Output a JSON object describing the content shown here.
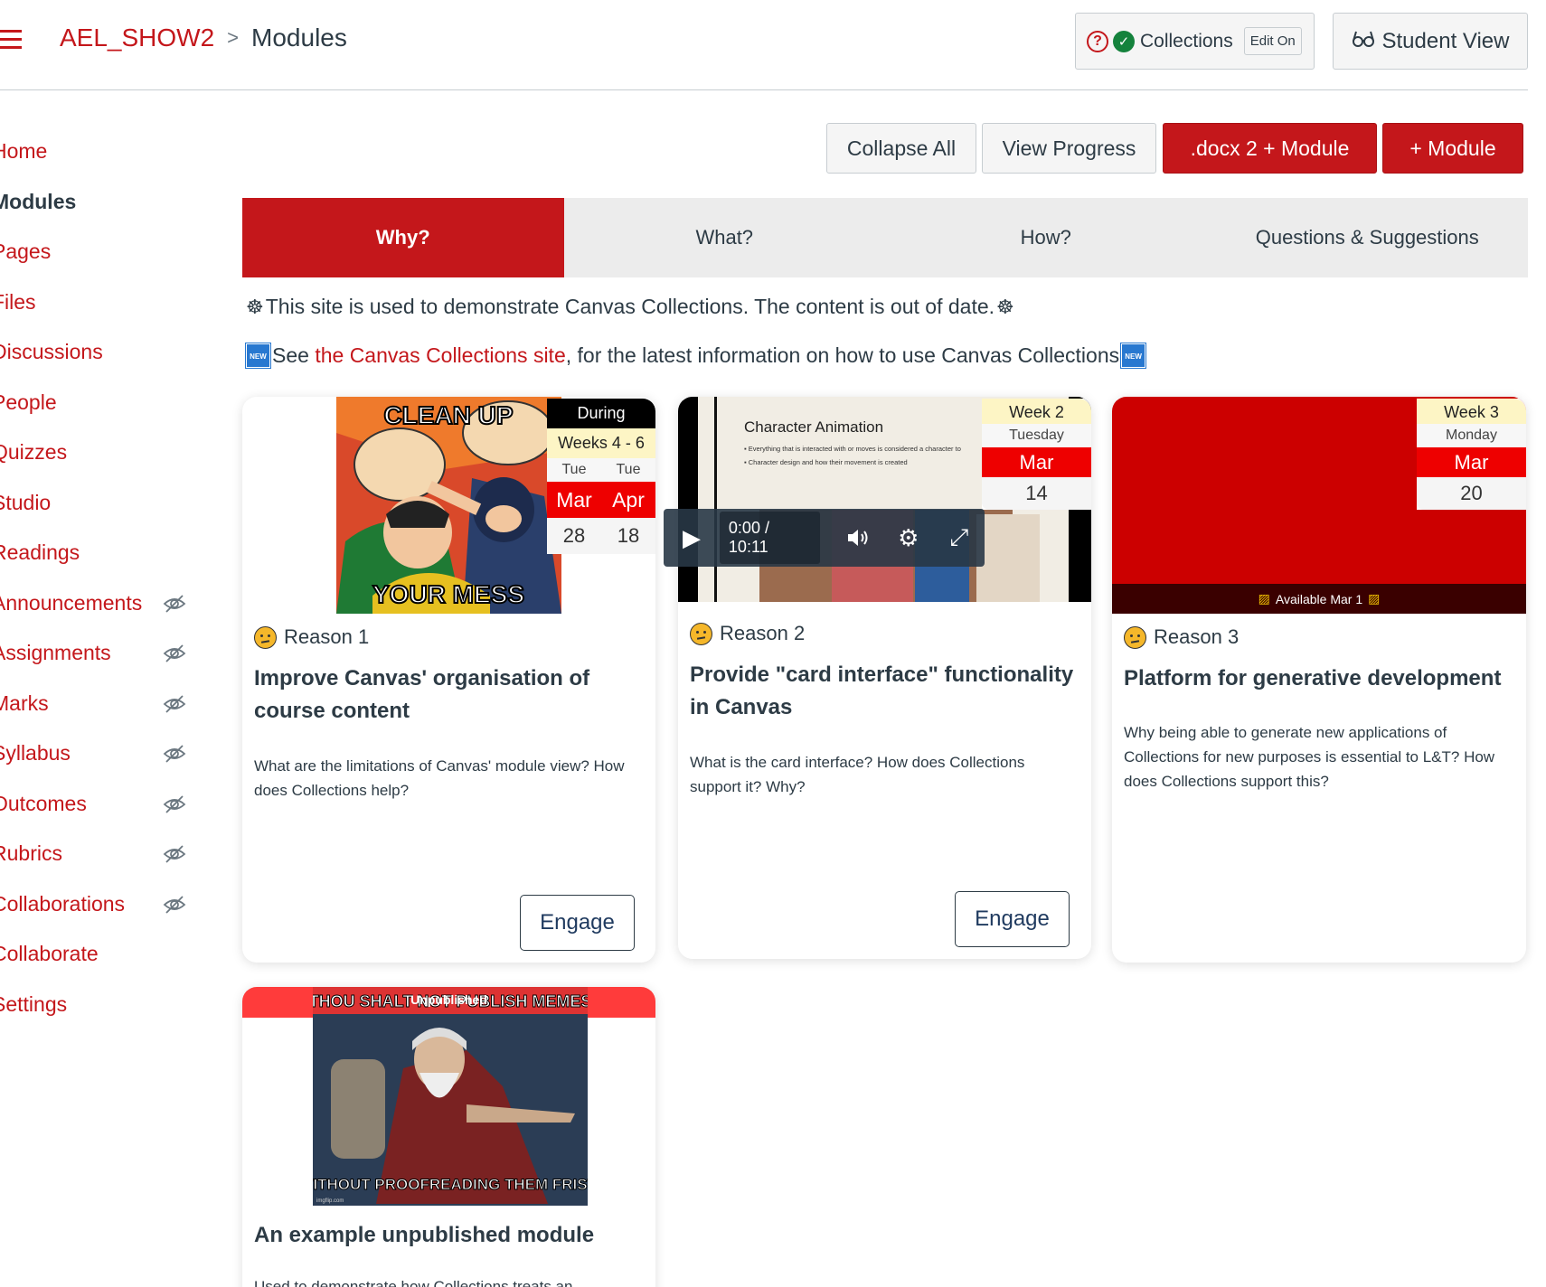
{
  "header": {
    "course": "AEL_SHOW2",
    "separator": ">",
    "page": "Modules",
    "collections_label": "Collections",
    "edit_label": "Edit On",
    "student_view_label": "Student View"
  },
  "sidebar": {
    "items": [
      {
        "label": "Home",
        "hidden": false,
        "active": false
      },
      {
        "label": "Modules",
        "hidden": false,
        "active": true
      },
      {
        "label": "Pages",
        "hidden": false,
        "active": false
      },
      {
        "label": "Files",
        "hidden": false,
        "active": false
      },
      {
        "label": "Discussions",
        "hidden": false,
        "active": false
      },
      {
        "label": "People",
        "hidden": false,
        "active": false
      },
      {
        "label": "Quizzes",
        "hidden": false,
        "active": false
      },
      {
        "label": "Studio",
        "hidden": false,
        "active": false
      },
      {
        "label": "Readings",
        "hidden": false,
        "active": false
      },
      {
        "label": "Announcements",
        "hidden": true,
        "active": false
      },
      {
        "label": "Assignments",
        "hidden": true,
        "active": false
      },
      {
        "label": "Marks",
        "hidden": true,
        "active": false
      },
      {
        "label": "Syllabus",
        "hidden": true,
        "active": false
      },
      {
        "label": "Outcomes",
        "hidden": true,
        "active": false
      },
      {
        "label": "Rubrics",
        "hidden": true,
        "active": false
      },
      {
        "label": "Collaborations",
        "hidden": true,
        "active": false
      },
      {
        "label": "Collaborate",
        "hidden": false,
        "active": false
      },
      {
        "label": "Settings",
        "hidden": false,
        "active": false
      }
    ]
  },
  "toolbar": {
    "collapse_all": "Collapse All",
    "view_progress": "View Progress",
    "docx_module": ".docx 2 + Module",
    "add_module": "+ Module"
  },
  "tabs": [
    "Why?",
    "What?",
    "How?",
    "Questions & Suggestions"
  ],
  "notices": {
    "line1": "This site is used to demonstrate Canvas Collections. The content is out of date.",
    "line2_pre": "See ",
    "line2_link": "the Canvas Collections site",
    "line2_post": ", for the latest information on how to use Canvas Collections",
    "new_icon_text": "NEW"
  },
  "cards": [
    {
      "label": "Reason 1",
      "title": "Improve Canvas' organisation of course content",
      "description": "What are the  limitations of Canvas' module view? How does Collections help?",
      "button": "Engage",
      "image_top_text": "CLEAN UP",
      "image_bottom_text": "YOUR MESS",
      "date": {
        "status": "During",
        "weeks": "Weeks 4 - 6",
        "days": [
          "Tue",
          "Tue"
        ],
        "months": [
          "Mar",
          "Apr"
        ],
        "nums": [
          "28",
          "18"
        ]
      }
    },
    {
      "label": "Reason 2",
      "title": "Provide \"card interface\" functionality in Canvas",
      "description": "What is the card interface? How does Collections support it? Why?",
      "button": "Engage",
      "video_title": "Character Animation",
      "video_bullets": [
        "Everything that is interacted with or moves is considered a character to",
        "Character design and how their movement is created"
      ],
      "video_time": "0:00 / 10:11",
      "date": {
        "week": "Week 2",
        "day": "Tuesday",
        "month": "Mar",
        "num": "14"
      }
    },
    {
      "label": "Reason 3",
      "title": "Platform for generative development",
      "description": "Why being able to generate new applications of Collections for new purposes is essential to L&T? How does Collections support this?",
      "available": "Available Mar 1",
      "date": {
        "week": "Week 3",
        "day": "Monday",
        "month": "Mar",
        "num": "20"
      }
    },
    {
      "title": "An example unpublished module",
      "description": "Used to demonstrate how Collections treats an",
      "unpublished": "Unpublished",
      "image_top_text": "THOU SHALT NOT PUBLISH MEMES",
      "image_bottom_text": "WITHOUT PROOFREADING THEM FRIST!",
      "image_credit": "imgflip.com"
    }
  ],
  "colors": {
    "brand": "#c4171b",
    "date_red": "#ee0000",
    "text": "#2d3b45"
  }
}
